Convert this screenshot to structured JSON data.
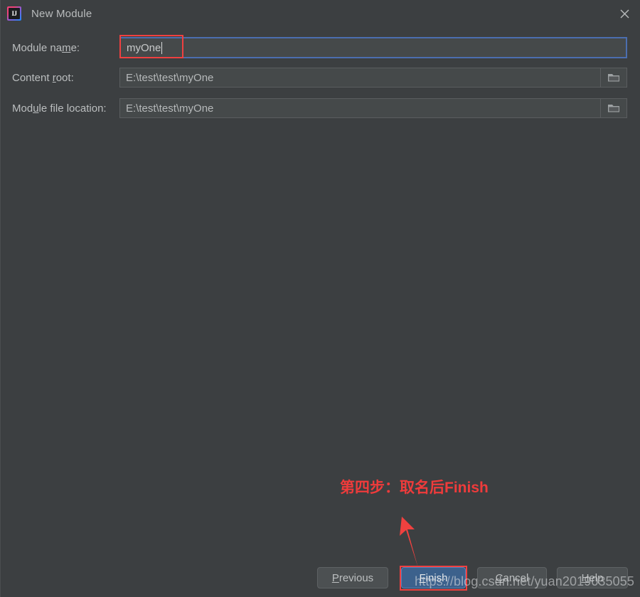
{
  "window": {
    "title": "New Module",
    "app_icon": "intellij-idea-icon",
    "icon_letters": "IJ",
    "close_icon": "close-icon",
    "background_color": "#3c3f41"
  },
  "form": {
    "rows": [
      {
        "label_before": "Module na",
        "label_mnemonic": "m",
        "label_after": "e:",
        "value": "myOne",
        "field_kind": "text",
        "focused": true,
        "browse_icon": null
      },
      {
        "label_before": "Content ",
        "label_mnemonic": "r",
        "label_after": "oot:",
        "value": "E:\\test\\test\\myOne",
        "field_kind": "path",
        "focused": false,
        "browse_icon": "folder-icon"
      },
      {
        "label_before": "Mod",
        "label_mnemonic": "u",
        "label_after": "le file location:",
        "value": "E:\\test\\test\\myOne",
        "field_kind": "path",
        "focused": false,
        "browse_icon": "folder-icon"
      }
    ]
  },
  "buttons": {
    "previous": {
      "before": "",
      "mnemonic": "P",
      "after": "revious"
    },
    "finish": {
      "before": "",
      "mnemonic": "F",
      "after": "inish"
    },
    "cancel": {
      "before": "",
      "mnemonic": "C",
      "after": "ancel"
    },
    "help": {
      "before": "",
      "mnemonic": "H",
      "after": "elp"
    }
  },
  "annotations": {
    "text": "第四步：取名后Finish",
    "color": "#ef3b3b",
    "arrow_icon": "red-arrow-up-icon",
    "highlight_name_field": true,
    "highlight_finish_button": true
  },
  "watermark": {
    "text": "https://blog.csdn.net/yuan2019035055"
  }
}
